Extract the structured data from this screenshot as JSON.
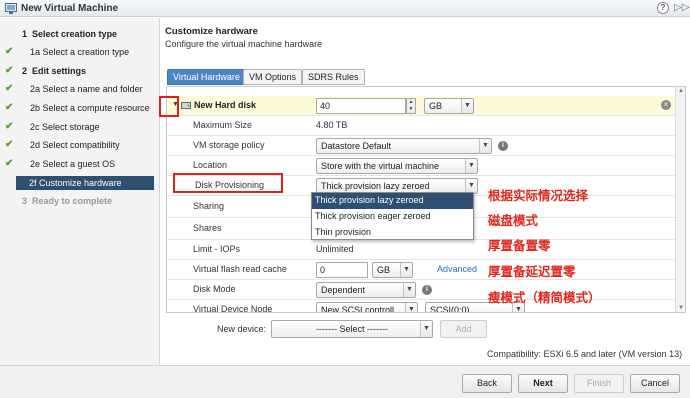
{
  "window": {
    "title": "New Virtual Machine",
    "help_glyph": "?",
    "expand_glyph": "▷▷"
  },
  "sidebar": {
    "steps": [
      {
        "num": "1",
        "label": "Select creation type",
        "done": false,
        "bold": true
      },
      {
        "num": "1a",
        "label": "Select a creation type",
        "done": true
      },
      {
        "num": "2",
        "label": "Edit settings",
        "done": true,
        "bold": true
      },
      {
        "num": "2a",
        "label": "Select a name and folder",
        "done": true
      },
      {
        "num": "2b",
        "label": "Select a compute resource",
        "done": true
      },
      {
        "num": "2c",
        "label": "Select storage",
        "done": true
      },
      {
        "num": "2d",
        "label": "Select compatibility",
        "done": true
      },
      {
        "num": "2e",
        "label": "Select a guest OS",
        "done": true
      },
      {
        "num": "2f",
        "label": "Customize hardware",
        "active": true
      },
      {
        "num": "3",
        "label": "Ready to complete",
        "disabled": true
      }
    ],
    "check_glyph": "✔"
  },
  "header": {
    "title": "Customize hardware",
    "subtitle": "Configure the virtual machine hardware"
  },
  "tabs": [
    "Virtual Hardware",
    "VM Options",
    "SDRS Rules"
  ],
  "disk": {
    "title": "New Hard disk",
    "size_value": "40",
    "size_unit": "GB",
    "rows": {
      "max_size_label": "Maximum Size",
      "max_size_value": "4.80 TB",
      "policy_label": "VM storage policy",
      "policy_value": "Datastore Default",
      "location_label": "Location",
      "location_value": "Store with the virtual machine",
      "provisioning_label": "Disk Provisioning",
      "provisioning_value": "Thick provision lazy zeroed",
      "sharing_label": "Sharing",
      "shares_label": "Shares",
      "limit_label": "Limit - IOPs",
      "limit_value": "Unlimited",
      "flash_label": "Virtual flash read cache",
      "flash_value": "0",
      "flash_unit": "GB",
      "flash_link": "Advanced",
      "mode_label": "Disk Mode",
      "mode_value": "Dependent",
      "node_label": "Virtual Device Node",
      "node_value": "New SCSI controll...",
      "node_slot": "SCSI(0:0)"
    },
    "provisioning_options": [
      "Thick provision lazy zeroed",
      "Thick provision eager zeroed",
      "Thin provision"
    ],
    "selected_option_index": 0
  },
  "annotations": [
    "根据实际情况选择",
    "磁盘模式",
    "厚置备置零",
    "厚置备延迟置零",
    "瘦模式（精简模式）"
  ],
  "new_device": {
    "label": "New device:",
    "select_value": "------- Select -------",
    "add_label": "Add"
  },
  "compatibility": "Compatibility: ESXi 6.5 and later (VM version 13)",
  "footer": {
    "back": "Back",
    "next": "Next",
    "finish": "Finish",
    "cancel": "Cancel"
  },
  "colors": {
    "accent": "#2c4f72",
    "tab_active": "#4a86c5",
    "annotation": "#e0281e",
    "check": "#5a9e2b"
  }
}
